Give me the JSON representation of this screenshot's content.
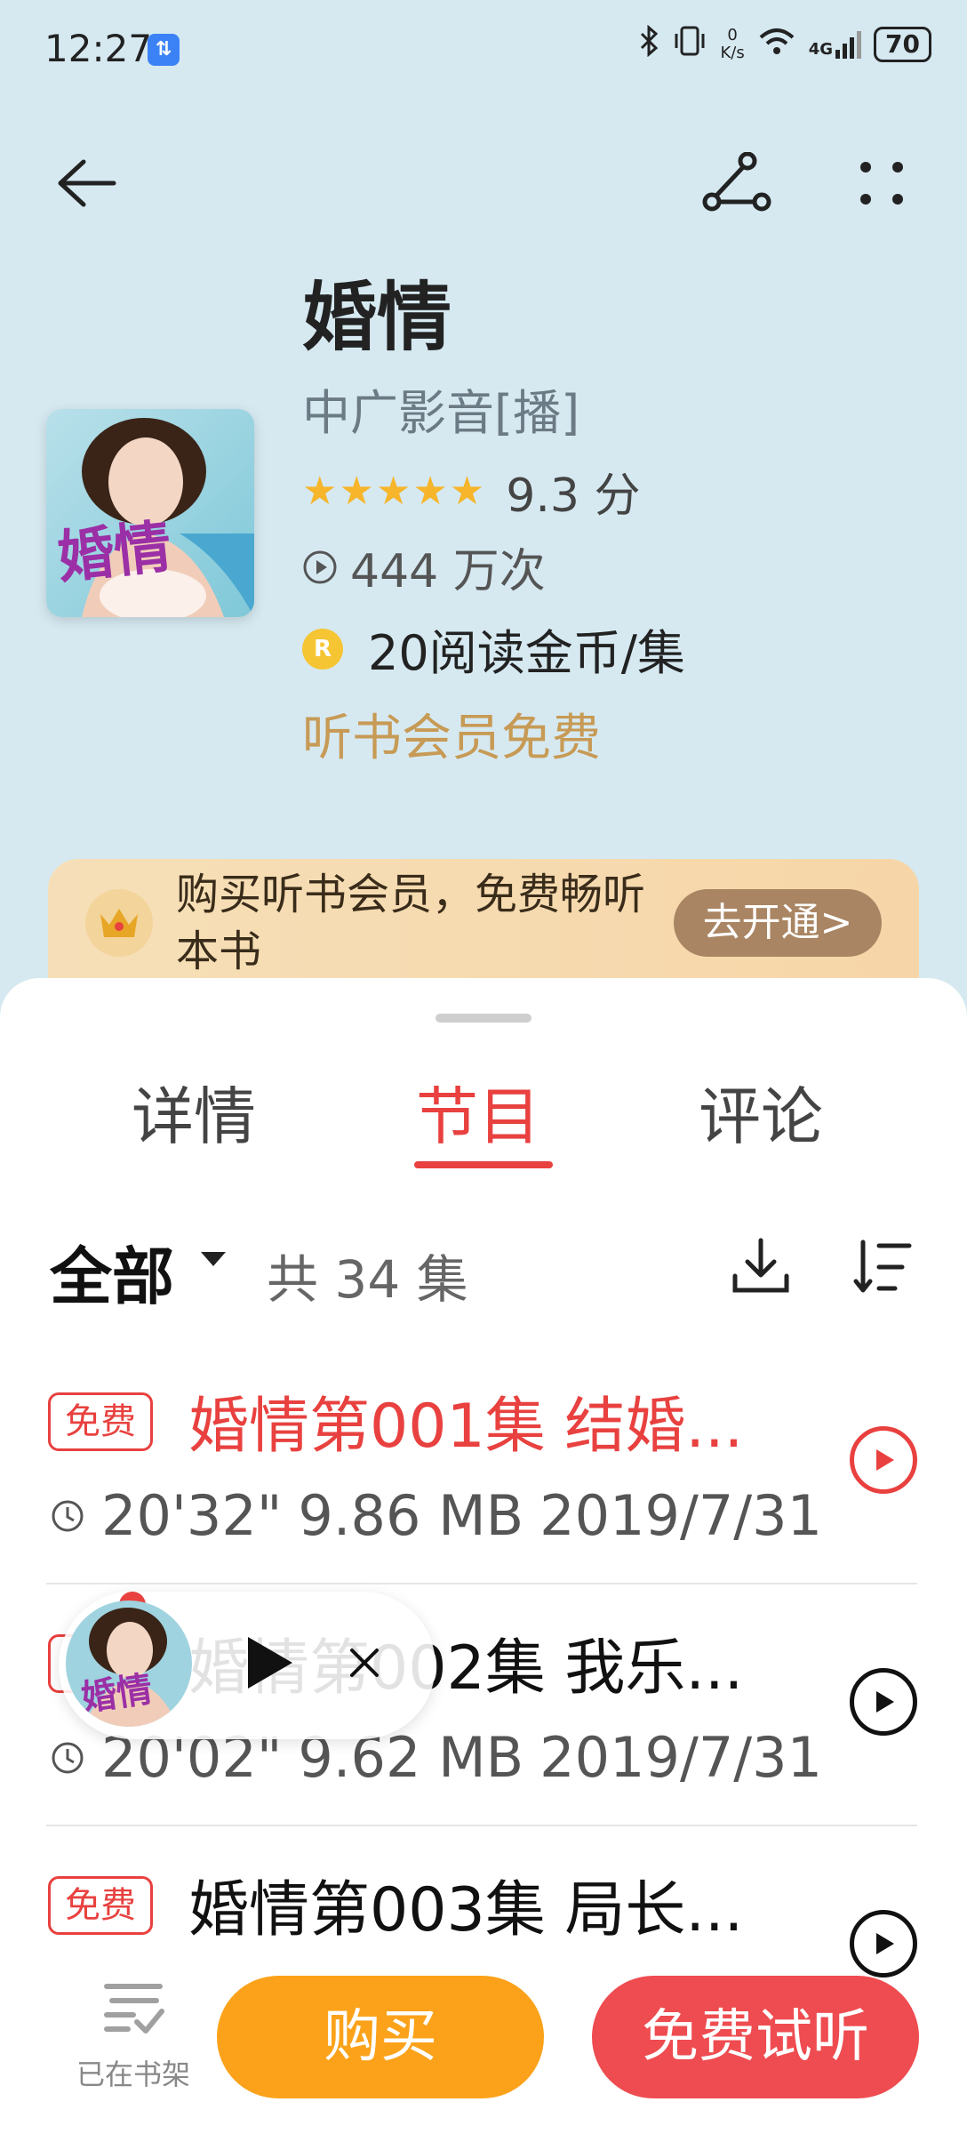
{
  "status_bar": {
    "time": "12:27",
    "badge": "⇅",
    "net_speed_value": "0",
    "net_speed_unit": "K/s",
    "network": "4G",
    "battery": "70"
  },
  "book": {
    "title": "婚情",
    "author": "中广影音[播]",
    "rating": "9.3 分",
    "stars": "★★★★★",
    "plays": "444 万次",
    "price": "20阅读金币/集",
    "coin_symbol": "R",
    "member_note": "听书会员免费",
    "cover_text": "婚情"
  },
  "promo": {
    "text": "购买听书会员，免费畅听本书",
    "button": "去开通>"
  },
  "tabs": [
    {
      "label": "详情"
    },
    {
      "label": "节目"
    },
    {
      "label": "评论"
    }
  ],
  "filter": {
    "label": "全部",
    "count": "共 34 集"
  },
  "episodes": [
    {
      "badge": "免费",
      "title": "婚情第001集 结婚...",
      "duration": "20'32\"",
      "size": "9.86 MB",
      "date": "2019/7/31"
    },
    {
      "badge": "免费",
      "title": "婚情第002集 我乐...",
      "duration": "20'02\"",
      "size": "9.62 MB",
      "date": "2019/7/31"
    },
    {
      "badge": "免费",
      "title": "婚情第003集 局长...",
      "duration": "",
      "size": "",
      "date": ""
    }
  ],
  "bottom_bar": {
    "shelf_label": "已在书架",
    "buy": "购买",
    "trial": "免费试听"
  },
  "colors": {
    "accent_red": "#e8413f",
    "orange": "#fba21a",
    "gold": "#c79a55",
    "header_bg": "#d6e9f1"
  }
}
